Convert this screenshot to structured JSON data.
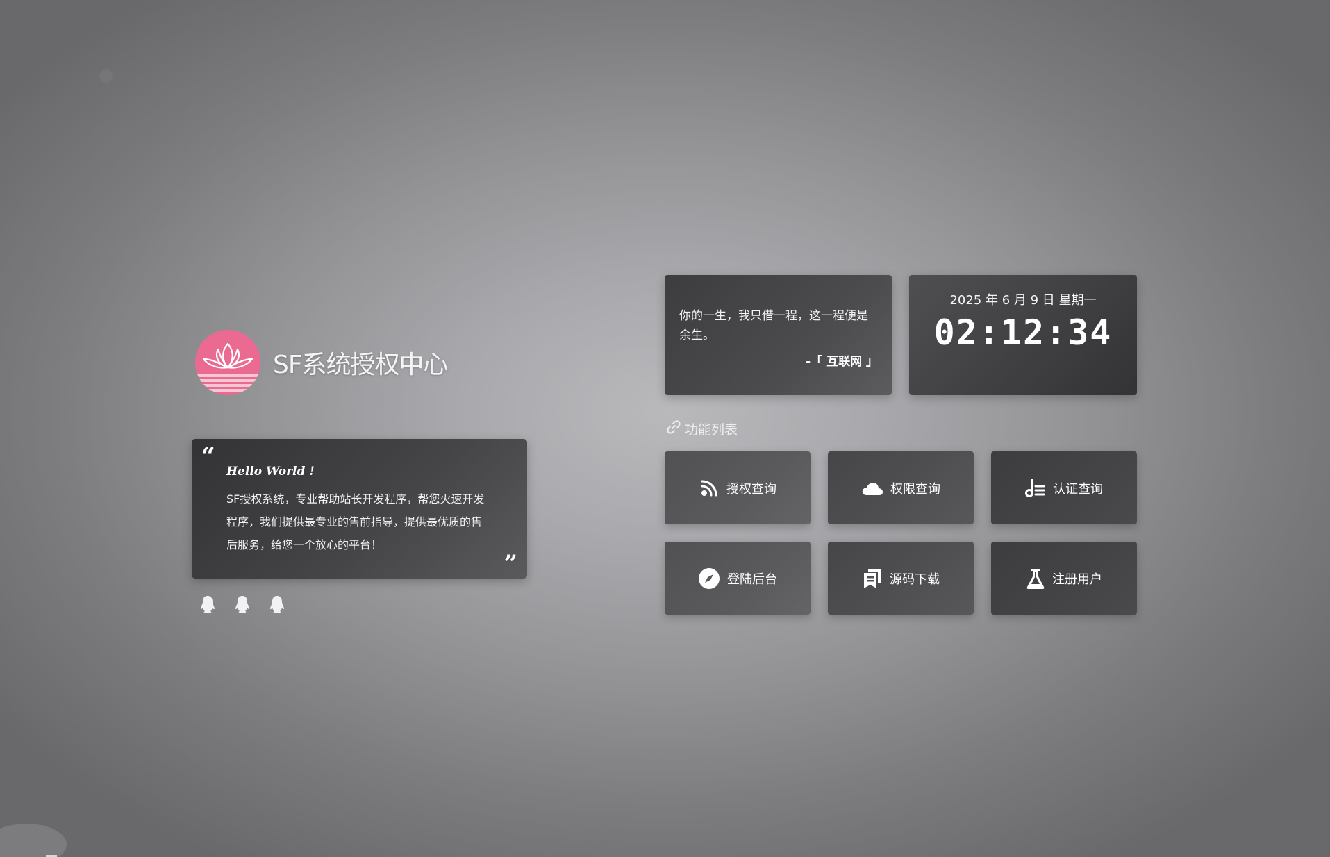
{
  "brand": {
    "title": "SF系统授权中心"
  },
  "intro": {
    "hello": "Hello World !",
    "body": "SF授权系统，专业帮助站长开发程序，帮您火速开发程序，我们提供最专业的售前指导，提供最优质的售后服务，给您一个放心的平台！"
  },
  "contact_icons": [
    "qq-icon",
    "qq-icon",
    "qq-icon"
  ],
  "quote": {
    "text": "你的一生，我只借一程，这一程便是余生。",
    "source": "-「 互联网 」"
  },
  "clock": {
    "date": "2025 年 6 月 9 日 星期一",
    "time": "02:12:34"
  },
  "features": {
    "heading": "功能列表",
    "items": [
      {
        "label": "授权查询",
        "icon": "rss-icon"
      },
      {
        "label": "权限查询",
        "icon": "cloud-icon"
      },
      {
        "label": "认证查询",
        "icon": "music-list-icon"
      },
      {
        "label": "登陆后台",
        "icon": "compass-icon"
      },
      {
        "label": "源码下载",
        "icon": "download-icon"
      },
      {
        "label": "注册用户",
        "icon": "flask-icon"
      }
    ]
  },
  "colors": {
    "logo_pink": "#ea6a91",
    "card_dark": "#3d3d3f"
  }
}
